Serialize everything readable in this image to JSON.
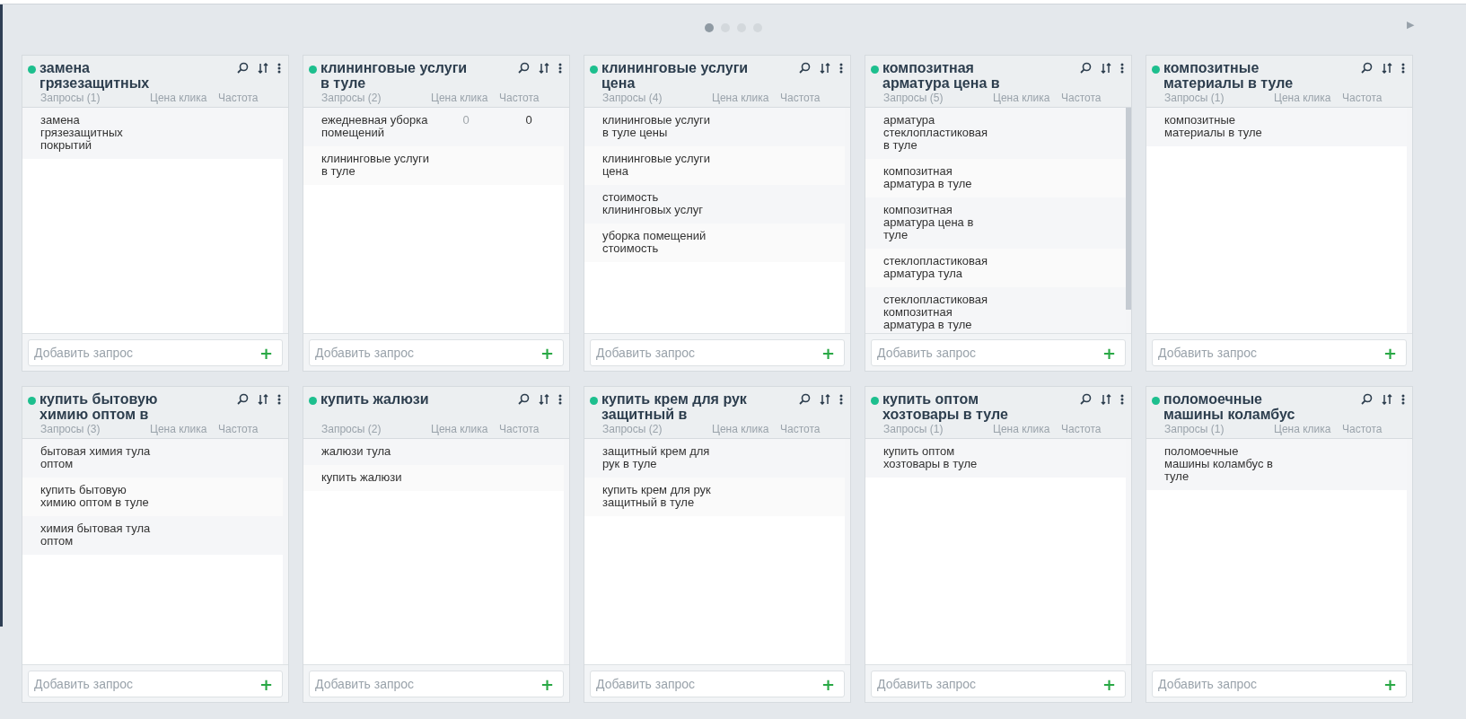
{
  "pager": {
    "pages": [
      {
        "selected": true
      },
      {
        "selected": false
      },
      {
        "selected": false
      },
      {
        "selected": false
      }
    ],
    "next": "▶"
  },
  "columns": [
    {
      "title": "замена грязезащитных",
      "count": "Запросы (1)",
      "price_label": "Цена клика",
      "freq_label": "Частота",
      "queries": [
        {
          "text": "замена грязезащитных покрытий"
        }
      ],
      "placeholder": "Добавить запрос",
      "add": "+"
    },
    {
      "title": "клининговые услуги в туле",
      "count": "Запросы (2)",
      "price_label": "Цена клика",
      "freq_label": "Частота",
      "queries": [
        {
          "text": "ежедневная уборка помещений",
          "price": "0",
          "frequency": "0"
        },
        {
          "text": "клининговые услуги в туле"
        }
      ],
      "placeholder": "Добавить запрос",
      "add": "+"
    },
    {
      "title": "клининговые услуги цена",
      "count": "Запросы (4)",
      "price_label": "Цена клика",
      "freq_label": "Частота",
      "queries": [
        {
          "text": "клининговые услуги в туле цены"
        },
        {
          "text": "клининговые услуги цена"
        },
        {
          "text": "стоимость клининговых услуг"
        },
        {
          "text": "уборка помещений стоимость"
        }
      ],
      "placeholder": "Добавить запрос",
      "add": "+"
    },
    {
      "title": "композитная арматура цена в",
      "count": "Запросы (5)",
      "price_label": "Цена клика",
      "freq_label": "Частота",
      "queries": [
        {
          "text": "арматура стеклопластиковая в туле"
        },
        {
          "text": "композитная арматура в туле"
        },
        {
          "text": "композитная арматура цена в туле"
        },
        {
          "text": "стеклопластиковая арматура тула"
        },
        {
          "text": "стеклопластиковая композитная арматура в туле"
        }
      ],
      "placeholder": "Добавить запрос",
      "add": "+"
    },
    {
      "title": "композитные материалы в туле",
      "count": "Запросы (1)",
      "price_label": "Цена клика",
      "freq_label": "Частота",
      "queries": [
        {
          "text": "композитные материалы в туле"
        }
      ],
      "placeholder": "Добавить запрос",
      "add": "+"
    },
    {
      "title": "купить бытовую химию оптом в",
      "count": "Запросы (3)",
      "price_label": "Цена клика",
      "freq_label": "Частота",
      "queries": [
        {
          "text": "бытовая химия тула оптом"
        },
        {
          "text": "купить бытовую химию оптом в туле"
        },
        {
          "text": "химия бытовая тула оптом"
        }
      ],
      "placeholder": "Добавить запрос",
      "add": "+"
    },
    {
      "title": "купить жалюзи",
      "count": "Запросы (2)",
      "price_label": "Цена клика",
      "freq_label": "Частота",
      "queries": [
        {
          "text": "жалюзи тула"
        },
        {
          "text": "купить жалюзи"
        }
      ],
      "placeholder": "Добавить запрос",
      "add": "+"
    },
    {
      "title": "купить крем для рук защитный в",
      "count": "Запросы (2)",
      "price_label": "Цена клика",
      "freq_label": "Частота",
      "queries": [
        {
          "text": "защитный крем для рук в туле"
        },
        {
          "text": "купить крем для рук защитный в туле"
        }
      ],
      "placeholder": "Добавить запрос",
      "add": "+"
    },
    {
      "title": "купить оптом хозтовары в туле",
      "count": "Запросы (1)",
      "price_label": "Цена клика",
      "freq_label": "Частота",
      "queries": [
        {
          "text": "купить оптом хозтовары в туле"
        }
      ],
      "placeholder": "Добавить запрос",
      "add": "+"
    },
    {
      "title": "поломоечные машины коламбус",
      "count": "Запросы (1)",
      "price_label": "Цена клика",
      "freq_label": "Частота",
      "queries": [
        {
          "text": "поломоечные машины коламбус в туле"
        }
      ],
      "placeholder": "Добавить запрос",
      "add": "+"
    }
  ]
}
